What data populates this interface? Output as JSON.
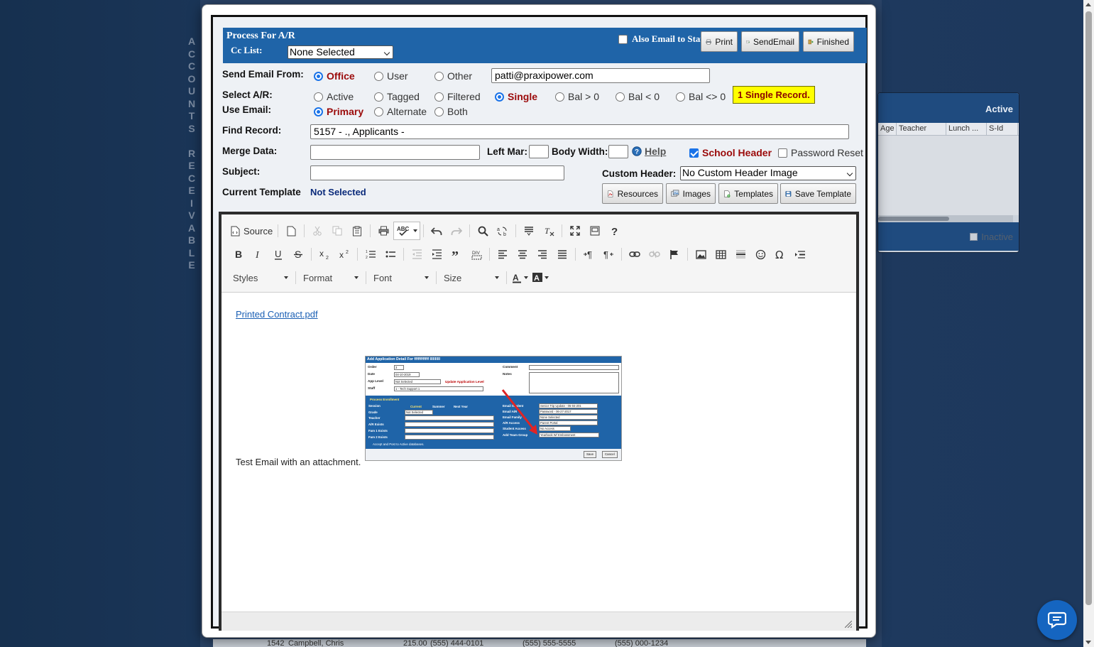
{
  "background": {
    "vertical_title_letters": [
      "A",
      "C",
      "C",
      "O",
      "U",
      "N",
      "T",
      "S",
      " ",
      "R",
      "E",
      "C",
      "E",
      "I",
      "V",
      "A",
      "B",
      "L",
      "E"
    ],
    "side_panel": {
      "title": "Active",
      "columns": [
        "Age",
        "Teacher",
        "Lunch ...",
        "S-Id"
      ],
      "footer_label": "Inactive"
    },
    "bottom_row": [
      "1542",
      "Campbell, Chris",
      "215.00",
      "(555) 444-0101",
      "(555) 555-5555",
      "(555) 000-1234"
    ]
  },
  "dialog": {
    "header": {
      "title": "Process For A/R",
      "cc_label": "Cc List:",
      "cc_value": "None Selected",
      "also_email_label": "Also Email to Staff",
      "buttons": {
        "print": "Print",
        "send_email": "SendEmail",
        "finished": "Finished"
      }
    },
    "send_from": {
      "label": "Send Email From:",
      "options": [
        "Office",
        "User",
        "Other"
      ],
      "selected": "Office",
      "email": "patti@praxipower.com"
    },
    "select_ar": {
      "label": "Select A/R:",
      "options": [
        "Active",
        "Tagged",
        "Filtered",
        "Single",
        "Bal > 0",
        "Bal < 0",
        "Bal <> 0"
      ],
      "selected": "Single",
      "badge": "1 Single Record."
    },
    "use_email": {
      "label": "Use Email:",
      "options": [
        "Primary",
        "Alternate",
        "Both"
      ],
      "selected": "Primary"
    },
    "find_record": {
      "label": "Find Record:",
      "value": "5157 - ., Applicants -"
    },
    "merge_data": {
      "label": "Merge Data:",
      "value": "",
      "left_mar_label": "Left Mar:",
      "body_width_label": "Body Width:",
      "help_label": "Help",
      "school_header_label": "School Header",
      "password_reset_label": "Password Reset"
    },
    "subject": {
      "label": "Subject:",
      "value": "",
      "custom_header_label": "Custom Header:",
      "custom_header_value": "No Custom Header Image"
    },
    "template": {
      "label": "Current Template",
      "value": "Not Selected",
      "buttons": {
        "resources": "Resources",
        "images": "Images",
        "templates": "Templates",
        "save_template": "Save Template"
      }
    }
  },
  "editor": {
    "toolbar": {
      "source_label": "Source",
      "combos": {
        "styles": "Styles",
        "format": "Format",
        "font": "Font",
        "size": "Size"
      }
    },
    "content": {
      "link_text": "Printed Contract.pdf",
      "body_text": "Test Email with an attachment."
    },
    "embedded_image": {
      "title": "Add Application Detail For ffffffffffff llllllllll",
      "fields": {
        "order_label": "Order",
        "order_value": "3",
        "date_label": "Date",
        "date_value": "04-10-2019",
        "app_level_label": "App Level",
        "app_level_value": "Not Selected",
        "update_level_label": "Update Application Level",
        "staff_label": "Staff",
        "staff_value": "1 - Tech Support 1",
        "comment_label": "Comment",
        "notes_label": "Notes",
        "process_label": "Process Enrollment",
        "session_label": "Session",
        "session_options": [
          "Current",
          "Summer",
          "Next Year"
        ],
        "grade_label": "Grade",
        "grade_value": "Not Selected",
        "teacher_label": "Teacher",
        "ar_exists_label": "A/R Exists",
        "fam1_label": "Fam 1 Exists",
        "fam2_label": "Fam 2 Exists",
        "email_student_label": "Email Student",
        "email_student_value": "Senior Trip Update - 05-04-201",
        "email_ar_label": "Email A/R",
        "email_ar_value": "Password - 06-27-2017",
        "email_family_label": "Email Family",
        "email_family_value": "None Selected",
        "ar_access_label": "A/R Access",
        "ar_access_value": "Parent Portal",
        "student_access_label": "Student Access",
        "student_access_value": "No Access",
        "team_group_label": "Add Team Group",
        "team_group_value": "Yearbook W/ Embossment",
        "accept_label": "Accept and Post to Active databases.",
        "save_label": "Save",
        "cancel_label": "Cancel"
      }
    }
  },
  "colors": {
    "header_blue": "#1f64a8",
    "selected_red": "#9b0a0a",
    "badge_yellow": "#ffff00",
    "link_blue": "#1a5fb4",
    "fab_blue": "#1565c0"
  }
}
